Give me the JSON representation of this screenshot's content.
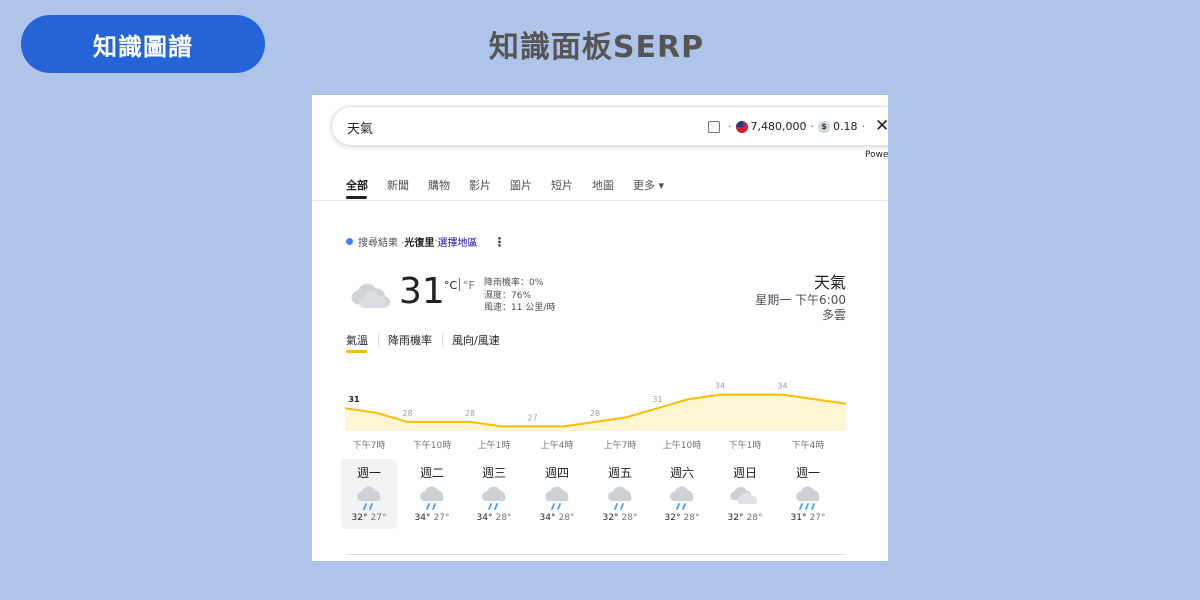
{
  "badge": {
    "label": "知識圖譜"
  },
  "page_title": "知識面板SERP",
  "search": {
    "query": "天氣",
    "count": "7,480,000",
    "cost": "0.18",
    "powered": "Powe"
  },
  "tabs": [
    {
      "label": "全部",
      "active": true
    },
    {
      "label": "新聞"
    },
    {
      "label": "購物"
    },
    {
      "label": "影片"
    },
    {
      "label": "圖片"
    },
    {
      "label": "短片"
    },
    {
      "label": "地圖"
    },
    {
      "label": "更多 ▾"
    }
  ],
  "source": {
    "prefix": "搜尋結果 · ",
    "location": "光復里",
    "sep": " · ",
    "link": "選擇地區",
    "menu_icon": "⋮"
  },
  "current": {
    "icon": "cloudy-icon",
    "temp": "31",
    "unit_c": "°C",
    "unit_f": "°F",
    "details": [
      "降雨機率：0%",
      "濕度：76%",
      "風速：11 公里/時"
    ]
  },
  "location": {
    "title": "天氣",
    "time": "星期一 下午6:00",
    "condition": "多雲"
  },
  "subtabs": [
    "氣溫",
    "降雨機率",
    "風向/風速"
  ],
  "colors": {
    "accent_blue": "#2464d6",
    "chart_line": "#fbbc04",
    "chart_fill": "#fef5d3",
    "background": "#aec4e8"
  },
  "chart_data": {
    "type": "area",
    "x": [
      "下午7時",
      "",
      "下午10時",
      "",
      "上午1時",
      "",
      "上午4時",
      "",
      "上午7時",
      "",
      "上午10時",
      "",
      "下午1時",
      "",
      "下午4時",
      ""
    ],
    "values": [
      31,
      30,
      28,
      28,
      28,
      27,
      27,
      27,
      28,
      29,
      31,
      33,
      34,
      34,
      34,
      33
    ],
    "labels": [
      "31",
      "",
      "28",
      "",
      "28",
      "",
      "27",
      "",
      "28",
      "",
      "31",
      "",
      "34",
      "",
      "34",
      ""
    ],
    "ylim": [
      26,
      35
    ]
  },
  "forecast": [
    {
      "day": "週一",
      "icon": "rain-icon",
      "hi": "32°",
      "lo": "27°",
      "selected": true
    },
    {
      "day": "週二",
      "icon": "rain-icon",
      "hi": "34°",
      "lo": "27°"
    },
    {
      "day": "週三",
      "icon": "rain-icon",
      "hi": "34°",
      "lo": "28°"
    },
    {
      "day": "週四",
      "icon": "rain-icon",
      "hi": "34°",
      "lo": "28°"
    },
    {
      "day": "週五",
      "icon": "rain-icon",
      "hi": "32°",
      "lo": "28°"
    },
    {
      "day": "週六",
      "icon": "rain-icon",
      "hi": "32°",
      "lo": "28°"
    },
    {
      "day": "週日",
      "icon": "cloudy-icon",
      "hi": "32°",
      "lo": "28°"
    },
    {
      "day": "週一",
      "icon": "heavy-rain-icon",
      "hi": "31°",
      "lo": "27°"
    }
  ]
}
